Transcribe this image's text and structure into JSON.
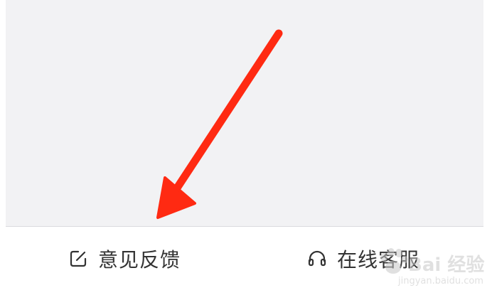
{
  "bottom_bar": {
    "feedback": {
      "label": "意见反馈",
      "icon": "edit-icon"
    },
    "customer_service": {
      "label": "在线客服",
      "icon": "headset-icon"
    }
  },
  "annotation": {
    "icon": "red-arrow",
    "color": "#ff2a12"
  },
  "watermark": {
    "brand": "Bai 经验",
    "url": "jingyan.baidu.com"
  },
  "colors": {
    "content_background": "#f2f2f4",
    "bar_background": "#ffffff",
    "text": "#333333"
  }
}
